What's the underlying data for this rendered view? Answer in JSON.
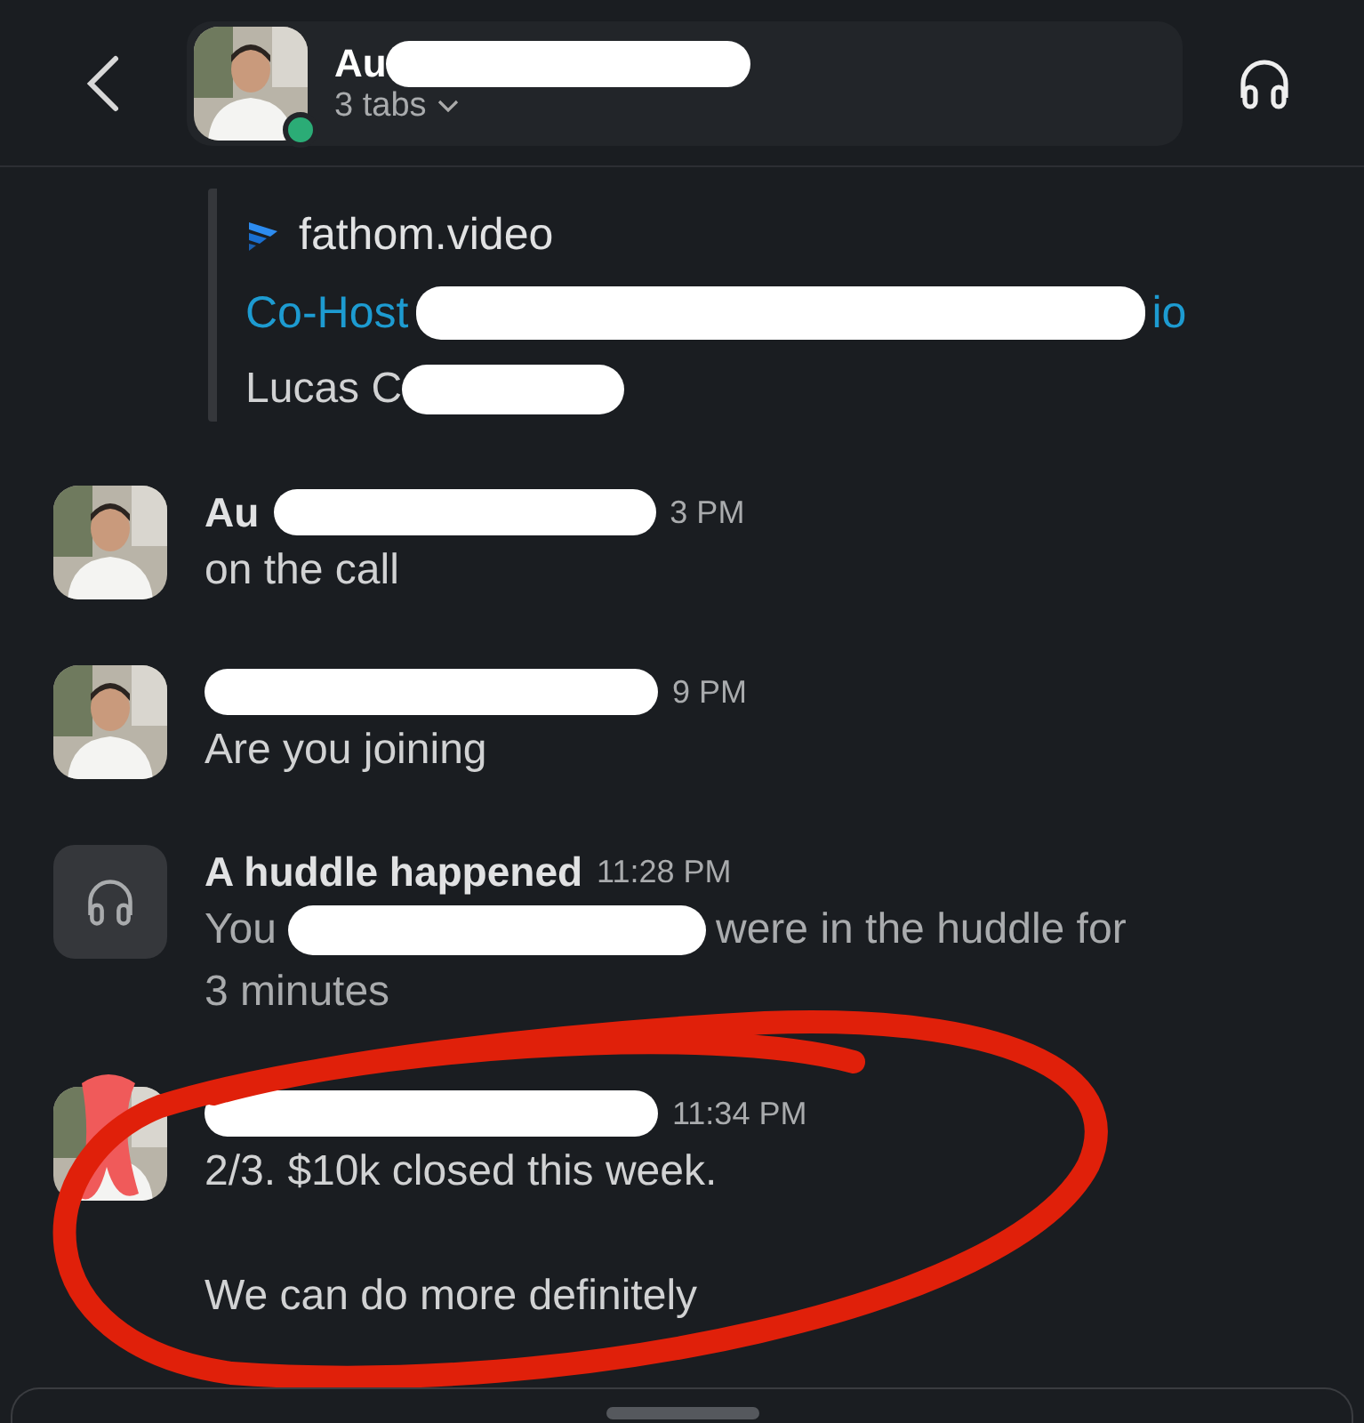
{
  "header": {
    "name": "Au",
    "subtitle": "3 tabs",
    "online": true
  },
  "attachment": {
    "source": "fathom.video",
    "title_start": "Co-Host",
    "title_end": "io",
    "author": "Lucas C"
  },
  "messages": [
    {
      "kind": "user",
      "name": "Au",
      "time": "3 PM",
      "text": "on the call"
    },
    {
      "kind": "user",
      "time": "9 PM",
      "text": "Are you joining"
    },
    {
      "kind": "huddle",
      "name": "A huddle happened",
      "time": "11:28 PM",
      "text_start": "You",
      "text_end": "were in the huddle for",
      "text_more": "3 minutes"
    },
    {
      "kind": "user",
      "time": "11:34 PM",
      "scribbled": true,
      "text": "2/3. $10k closed this week.\n\nWe can do more definitely"
    }
  ]
}
